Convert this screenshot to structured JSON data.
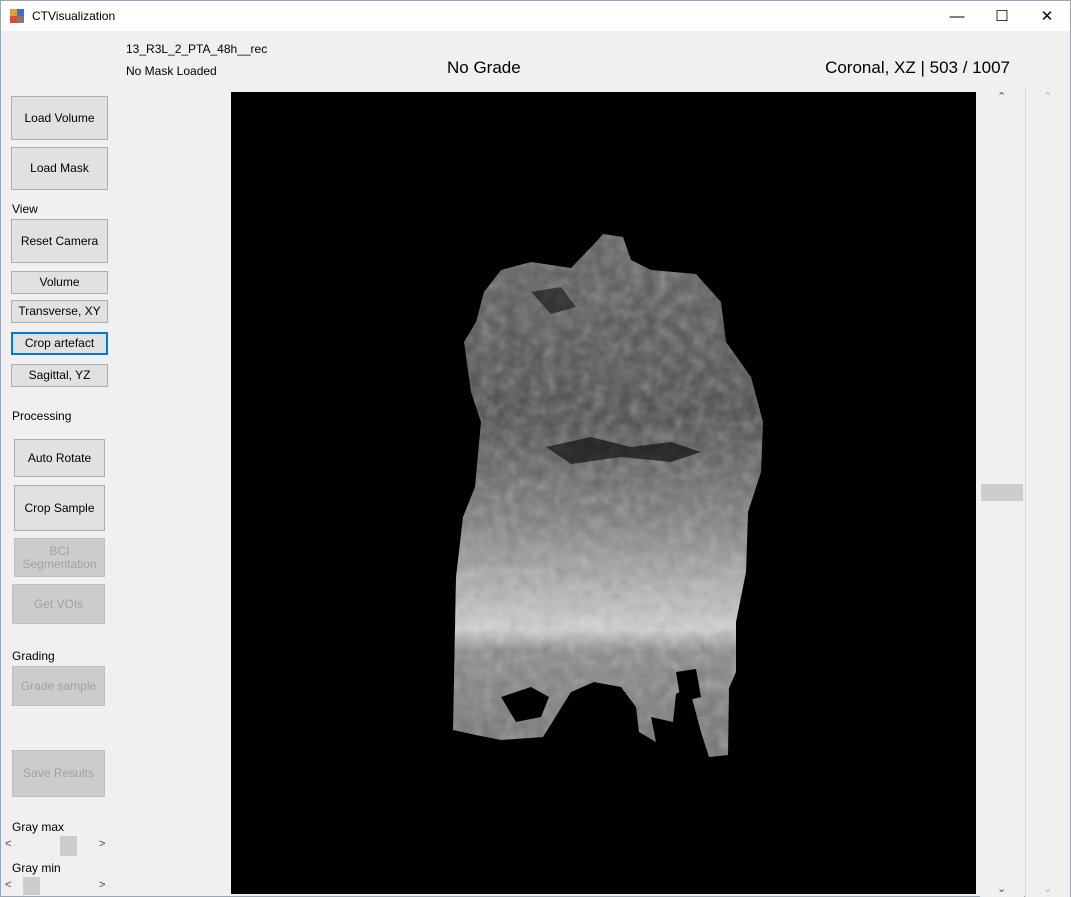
{
  "window": {
    "title": "CTVisualization",
    "minimize": "—",
    "maximize": "☐",
    "close": "✕"
  },
  "header": {
    "sample_name": "13_R3L_2_PTA_48h__rec",
    "mask_status": "No Mask Loaded",
    "grade": "No Grade",
    "slice_info": "Coronal, XZ | 503 / 1007"
  },
  "sidebar": {
    "load_volume": "Load Volume",
    "load_mask": "Load Mask",
    "view_label": "View",
    "reset_camera": "Reset Camera",
    "volume": "Volume",
    "transverse": "Transverse, XY",
    "crop_artefact": "Crop artefact",
    "sagittal": "Sagittal, YZ",
    "processing_label": "Processing",
    "auto_rotate": "Auto Rotate",
    "crop_sample": "Crop Sample",
    "bci_segmentation": "BCI\nSegmentation",
    "get_vois": "Get VOIs",
    "grading_label": "Grading",
    "grade_sample": "Grade sample",
    "save_results": "Save Results",
    "gray_max_label": "Gray max",
    "gray_min_label": "Gray min"
  },
  "sliders": {
    "slice_position_fraction": 0.5,
    "gray_max_fraction": 0.68,
    "gray_min_fraction": 0.12
  },
  "colors": {
    "accent": "#0078d7",
    "viewport_bg": "#000000"
  }
}
